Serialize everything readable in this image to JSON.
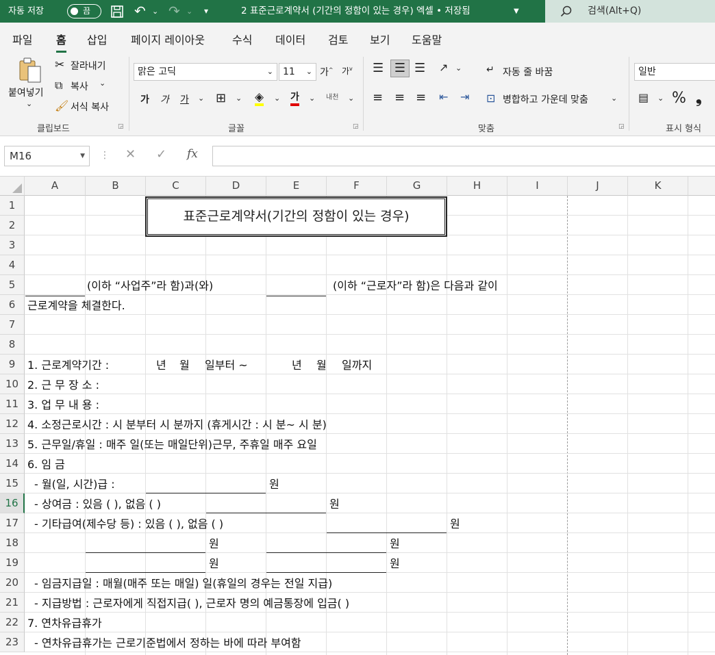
{
  "titlebar": {
    "autosave_label": "자동 저장",
    "autosave_state": "끔",
    "document_title": "2 표준근로계약서 (기간의 정함이 있는 경우) 엑셀 • 저장됨",
    "search_label": "검색(Alt+Q)"
  },
  "tabs": [
    "파일",
    "홈",
    "삽입",
    "페이지 레이아웃",
    "수식",
    "데이터",
    "검토",
    "보기",
    "도움말"
  ],
  "ribbon": {
    "clipboard": {
      "paste": "붙여넣기",
      "cut": "잘라내기",
      "copy": "복사",
      "format_painter": "서식 복사",
      "group": "클립보드"
    },
    "font": {
      "name": "맑은 고딕",
      "size": "11",
      "bold": "가",
      "italic": "가",
      "underline": "가",
      "font_color": "가",
      "phonetic": "내천",
      "group": "글꼴"
    },
    "alignment": {
      "wrap": "자동 줄 바꿈",
      "merge": "병합하고 가운데 맞춤",
      "group": "맞춤"
    },
    "number": {
      "format": "일반",
      "percent": "%",
      "comma": "❟",
      "group": "표시 형식"
    }
  },
  "formula_bar": {
    "name_box": "M16",
    "fx": "fx",
    "formula": ""
  },
  "columns": [
    "A",
    "B",
    "C",
    "D",
    "E",
    "F",
    "G",
    "H",
    "I",
    "J",
    "K"
  ],
  "rows": [
    "1",
    "2",
    "3",
    "4",
    "5",
    "6",
    "7",
    "8",
    "9",
    "10",
    "11",
    "12",
    "13",
    "14",
    "15",
    "16",
    "17",
    "18",
    "19",
    "20",
    "21",
    "22",
    "23"
  ],
  "selected_row": "16",
  "sheet": {
    "title": "표준근로계약서(기간의 정함이 있는 경우)",
    "r5_a": "(이하 “사업주”라 함)과(와)",
    "r5_b": "(이하 “근로자”라 함)은 다음과 같이",
    "r6": "근로계약을 체결한다.",
    "r9_a": "1. 근로계약기간 :",
    "r9_b": "년",
    "r9_c": "월",
    "r9_d": "일부터 ~",
    "r9_e": "년",
    "r9_f": "월",
    "r9_g": "일까지",
    "r10": "2. 근 무 장 소 :",
    "r11": "3. 업 무 내 용 :",
    "r12": "4. 소정근로시간 :   시   분부터   시   분까지 (휴게시간 :  시  분~  시   분)",
    "r13": "5. 근무일/휴일 : 매주   일(또는 매일단위)근무, 주휴일 매주   요일",
    "r14": "6. 임  금",
    "r15_a": "- 월(일, 시간)급 :",
    "r15_b": "원",
    "r16_a": "- 상여금 : 있음 (     ),  없음 (     )",
    "r16_b": "원",
    "r17_a": "- 기타급여(제수당 등) : 있음 (     ),   없음 (     )",
    "r17_b": "원",
    "r18_a": "원",
    "r18_b": "원",
    "r19_a": "원",
    "r19_b": "원",
    "r20": "- 임금지급일 : 매월(매주 또는 매일)        일(휴일의 경우는 전일 지급)",
    "r21": "- 지급방법 : 근로자에게 직접지급(     ),  근로자 명의 예금통장에 입금(     )",
    "r22": "7. 연차유급휴가",
    "r23": "- 연차유급휴가는 근로기준법에서 정하는 바에 따라 부여함"
  }
}
